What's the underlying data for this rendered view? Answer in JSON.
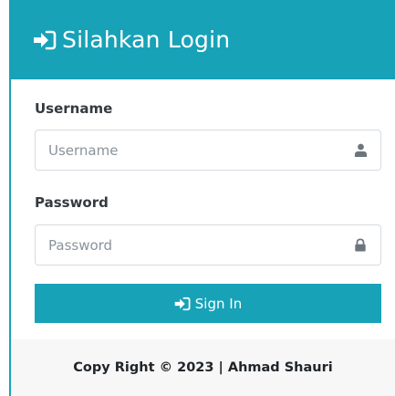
{
  "header": {
    "title": "Silahkan Login",
    "icon": "sign-in-icon"
  },
  "form": {
    "username": {
      "label": "Username",
      "placeholder": "Username",
      "value": "",
      "icon": "user-icon"
    },
    "password": {
      "label": "Password",
      "placeholder": "Password",
      "value": "",
      "icon": "lock-icon"
    },
    "submit": {
      "label": "Sign In",
      "icon": "sign-in-icon"
    }
  },
  "footer": {
    "text": "Copy Right © 2023 | Ahmad Shauri"
  },
  "colors": {
    "primary": "#17a2b8",
    "footer_bg": "#f7f7f7",
    "label_text": "#343a40",
    "icon": "#6c757d"
  }
}
